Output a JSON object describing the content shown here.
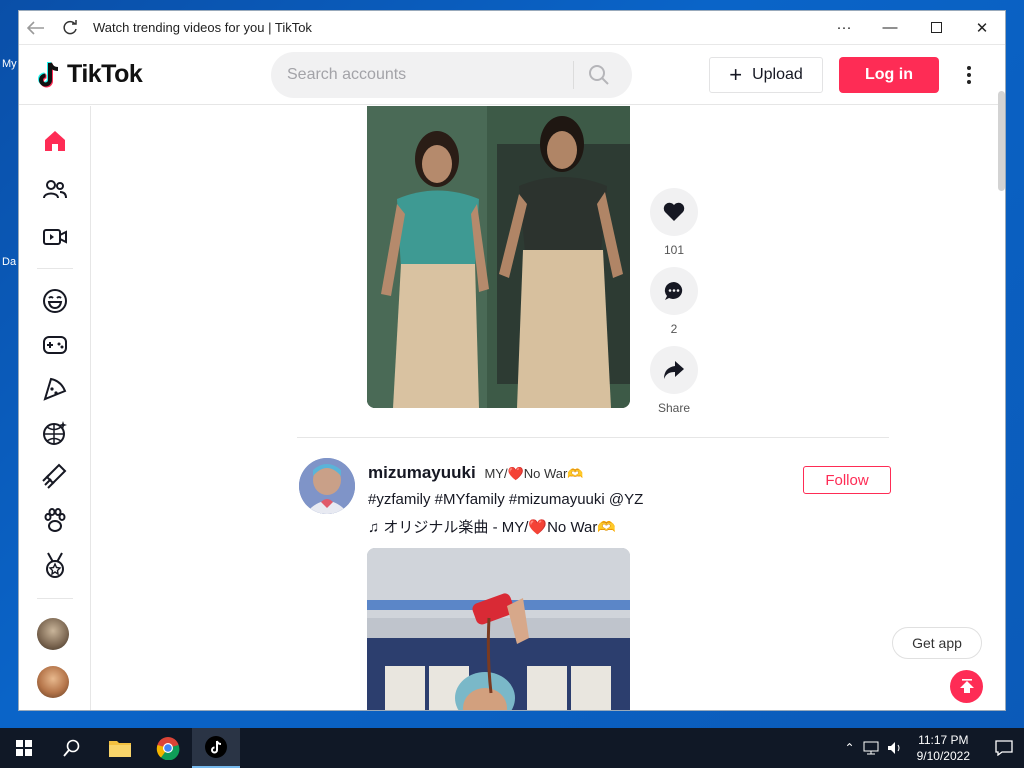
{
  "desktop": {
    "icon1_label": "My",
    "icon2_label": "Da"
  },
  "browser": {
    "title": "Watch trending videos for you | TikTok"
  },
  "header": {
    "logo_text": "TikTok",
    "search_placeholder": "Search accounts",
    "upload_label": "Upload",
    "login_label": "Log in"
  },
  "sidebar": {
    "items": [
      {
        "icon": "home-icon"
      },
      {
        "icon": "following-icon"
      },
      {
        "icon": "live-icon"
      },
      {
        "icon": "comedy-icon"
      },
      {
        "icon": "gaming-icon"
      },
      {
        "icon": "food-icon"
      },
      {
        "icon": "dance-icon"
      },
      {
        "icon": "beauty-icon"
      },
      {
        "icon": "animals-icon"
      },
      {
        "icon": "sports-icon"
      }
    ]
  },
  "video1": {
    "likes": "101",
    "comments": "2",
    "share_label": "Share"
  },
  "post2": {
    "username": "mizumayuuki",
    "nickname": "MY/❤️No War🫶",
    "caption": "#yzfamily #MYfamily #mizumayuuki @YZ",
    "music": "オリジナル楽曲 - MY/❤️No War🫶",
    "follow_label": "Follow"
  },
  "floating": {
    "get_app_label": "Get app"
  },
  "taskbar": {
    "time": "11:17 PM",
    "date": "9/10/2022"
  },
  "colors": {
    "brand": "#fe2c55",
    "taskbar": "#101826"
  }
}
